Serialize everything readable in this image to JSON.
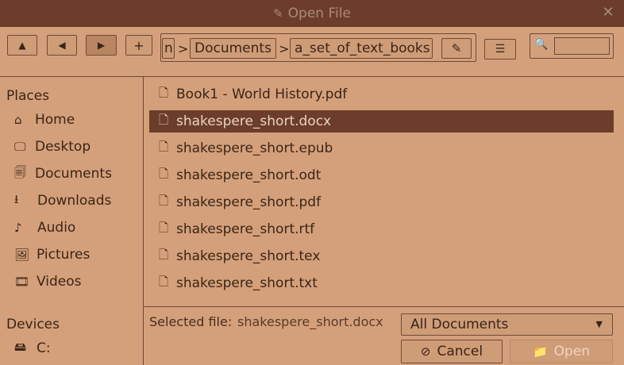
{
  "window": {
    "title": "Open File"
  },
  "toolbar": {
    "up_icon": "▲",
    "back_icon": "◀",
    "forward_icon": "▶",
    "new_folder_label": "+",
    "breadcrumbs": [
      "n",
      "Documents",
      "a_set_of_text_books"
    ],
    "separator": ">",
    "edit_path_icon": "✎",
    "view_menu_icon": "☰",
    "search_icon": "🔍",
    "search_value": ""
  },
  "sidebar": {
    "places_header": "Places",
    "places": [
      {
        "label": "Home",
        "icon": "⌂"
      },
      {
        "label": "Desktop",
        "icon": "🖵"
      },
      {
        "label": "Documents",
        "icon": "🗐"
      },
      {
        "label": "Downloads",
        "icon": "⭳"
      },
      {
        "label": "Audio",
        "icon": "♪"
      },
      {
        "label": "Pictures",
        "icon": "🖼"
      },
      {
        "label": "Videos",
        "icon": "🎞"
      }
    ],
    "devices_header": "Devices",
    "devices": [
      {
        "label": "C:",
        "icon": "🖴"
      }
    ]
  },
  "files": [
    {
      "name": "Book1 - World History.pdf",
      "icon": "🗋"
    },
    {
      "name": "shakespere_short.docx",
      "icon": "🗋",
      "selected": true
    },
    {
      "name": "shakespere_short.epub",
      "icon": "🗋"
    },
    {
      "name": "shakespere_short.odt",
      "icon": "🗋"
    },
    {
      "name": "shakespere_short.pdf",
      "icon": "🗋"
    },
    {
      "name": "shakespere_short.rtf",
      "icon": "🗋"
    },
    {
      "name": "shakespere_short.tex",
      "icon": "🗋"
    },
    {
      "name": "shakespere_short.txt",
      "icon": "🗋"
    }
  ],
  "footer": {
    "selected_label": "Selected file:",
    "selected_value": "shakespere_short.docx",
    "filter_value": "All Documents",
    "filter_arrow": "▼",
    "cancel_label": "Cancel",
    "cancel_icon": "⊘",
    "open_label": "Open",
    "open_icon": "📁"
  },
  "colors": {
    "background": "#d4a07b",
    "titlebar": "#6d3d2b",
    "selection": "#6d3d2b",
    "border": "#6e4a36"
  }
}
